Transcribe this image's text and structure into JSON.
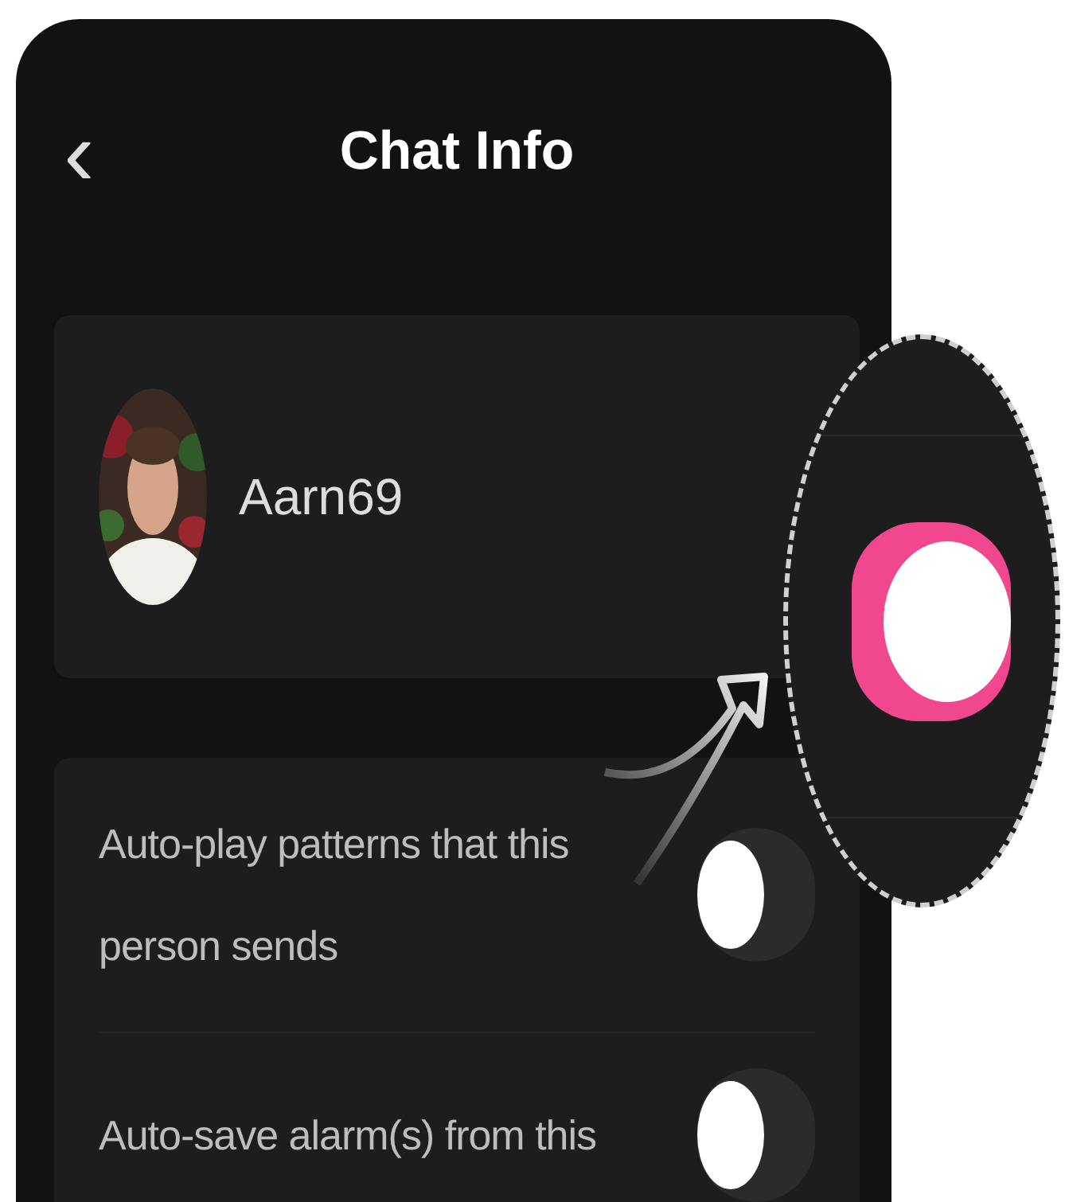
{
  "header": {
    "back": "‹",
    "title": "Chat Info"
  },
  "profile": {
    "name": "Aarn69"
  },
  "settings": [
    {
      "label": "Auto-play patterns that this person sends",
      "on": false
    },
    {
      "label": "Auto-save alarm(s) from this",
      "on": false
    }
  ],
  "callout": {
    "toggle": {
      "on": true
    }
  }
}
